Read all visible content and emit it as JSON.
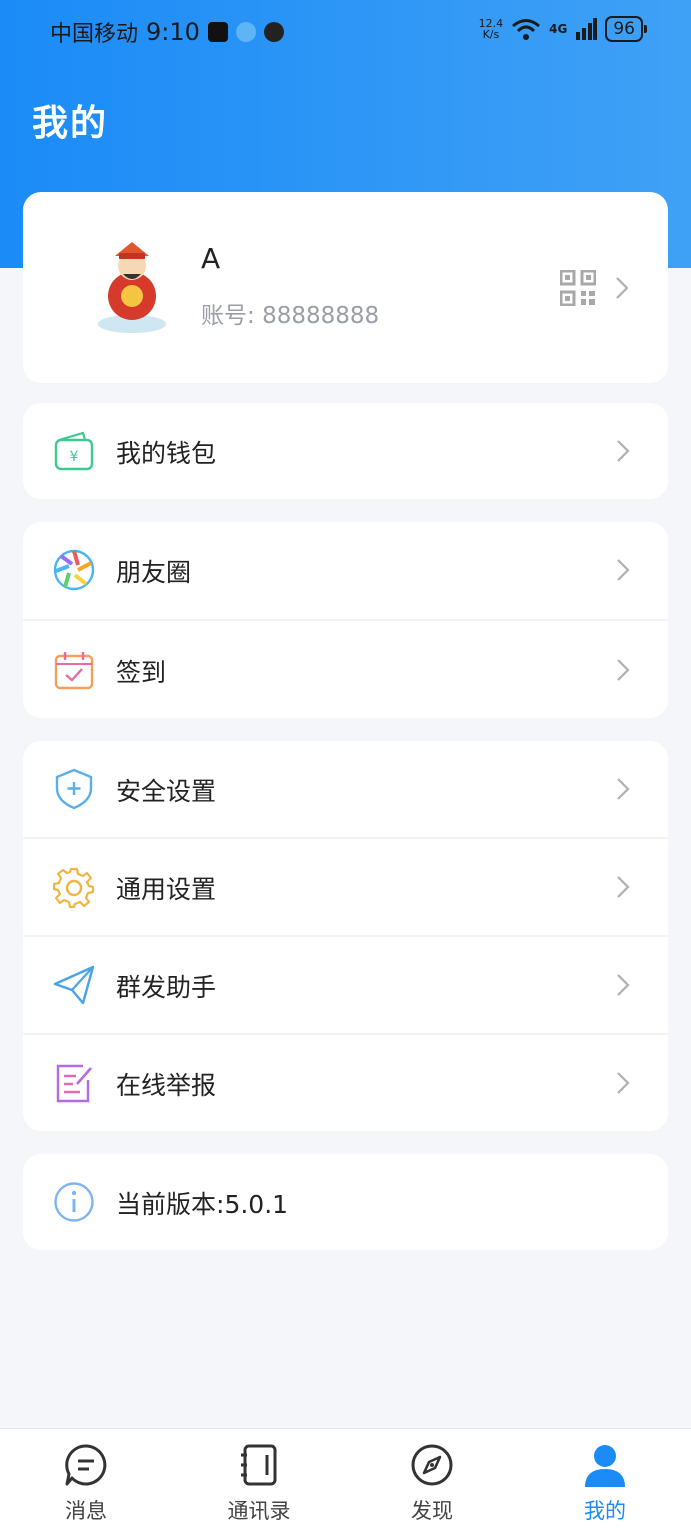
{
  "status_bar": {
    "carrier": "中国移动",
    "time": "9:10",
    "speed_value": "12.4",
    "speed_unit": "K/s",
    "network": "4G",
    "battery": "96"
  },
  "page": {
    "title": "我的"
  },
  "profile": {
    "nickname": "A",
    "account_label": "账号:",
    "account_number": "88888888"
  },
  "menu": {
    "wallet": "我的钱包",
    "moments": "朋友圈",
    "checkin": "签到",
    "security": "安全设置",
    "general": "通用设置",
    "broadcast": "群发助手",
    "report": "在线举报",
    "version_label": "当前版本:",
    "version_value": "5.0.1"
  },
  "nav": {
    "messages": "消息",
    "contacts": "通讯录",
    "discover": "发现",
    "me": "我的",
    "active_color": "#1b8bf7"
  },
  "colors": {
    "header_start": "#1b8bf7",
    "header_end": "#3fa1f6"
  }
}
